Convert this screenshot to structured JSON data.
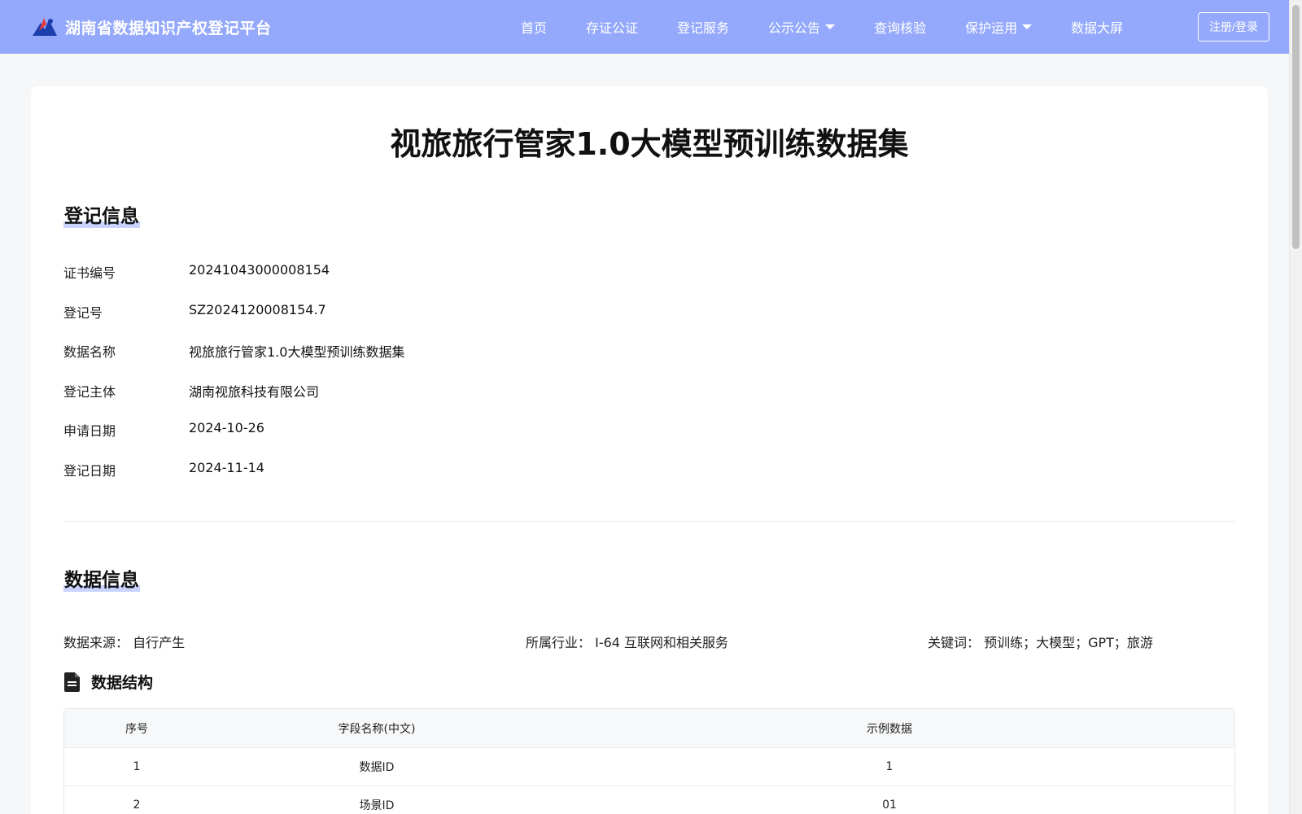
{
  "header": {
    "site_title": "湖南省数据知识产权登记平台",
    "logo_icon": "mountain-logo-icon",
    "nav": [
      {
        "label": "首页",
        "dropdown": false
      },
      {
        "label": "存证公证",
        "dropdown": false
      },
      {
        "label": "登记服务",
        "dropdown": false
      },
      {
        "label": "公示公告",
        "dropdown": true
      },
      {
        "label": "查询核验",
        "dropdown": false
      },
      {
        "label": "保护运用",
        "dropdown": true
      },
      {
        "label": "数据大屏",
        "dropdown": false
      }
    ],
    "login_label": "注册/登录",
    "bg_color": "#94a9fb"
  },
  "page": {
    "title": "视旅旅行管家1.0大模型预训练数据集"
  },
  "registration": {
    "section_title": "登记信息",
    "rows": [
      {
        "label": "证书编号",
        "value": "20241043000008154"
      },
      {
        "label": "登记号",
        "value": "SZ2024120008154.7"
      },
      {
        "label": "数据名称",
        "value": "视旅旅行管家1.0大模型预训练数据集"
      },
      {
        "label": "登记主体",
        "value": "湖南视旅科技有限公司"
      },
      {
        "label": "申请日期",
        "value": "2024-10-26"
      },
      {
        "label": "登记日期",
        "value": "2024-11-14"
      }
    ]
  },
  "data_info": {
    "section_title": "数据信息",
    "source_label": "数据来源：",
    "source_value": "自行产生",
    "industry_label": "所属行业：",
    "industry_value": "I-64 互联网和相关服务",
    "keywords_label": "关键词：",
    "keywords_value": "预训练；大模型；GPT；旅游",
    "structure_title": "数据结构",
    "structure_icon": "document-icon",
    "table": {
      "headers": [
        "序号",
        "字段名称(中文)",
        "示例数据"
      ],
      "rows": [
        [
          "1",
          "数据ID",
          "1"
        ],
        [
          "2",
          "场景ID",
          "01"
        ]
      ]
    }
  }
}
